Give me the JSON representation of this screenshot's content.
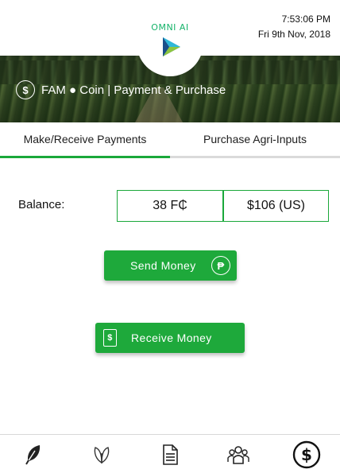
{
  "header": {
    "logo_text": "OMNI AI",
    "time": "7:53:06 PM",
    "date": "Fri 9th Nov, 2018",
    "title": "FAM ● Coin | Payment & Purchase",
    "title_icon": "dollar-circle-icon"
  },
  "tabs": [
    {
      "label": "Make/Receive Payments",
      "active": true
    },
    {
      "label": "Purchase Agri-Inputs",
      "active": false
    }
  ],
  "balance": {
    "label": "Balance:",
    "coin_value": "38 F₵",
    "usd_value": "$106 (US)"
  },
  "actions": {
    "send_label": "Send Money",
    "send_icon": "coin-send-icon",
    "receive_label": "Receive Money",
    "receive_icon": "receipt-dollar-icon"
  },
  "bottom_nav": [
    {
      "icon": "feather-icon",
      "active": false
    },
    {
      "icon": "leaf-icon",
      "active": false
    },
    {
      "icon": "document-icon",
      "active": false
    },
    {
      "icon": "group-icon",
      "active": false
    },
    {
      "icon": "dollar-circle-icon",
      "active": true
    }
  ],
  "colors": {
    "accent": "#1ea93b",
    "logo": "#16b36a"
  }
}
